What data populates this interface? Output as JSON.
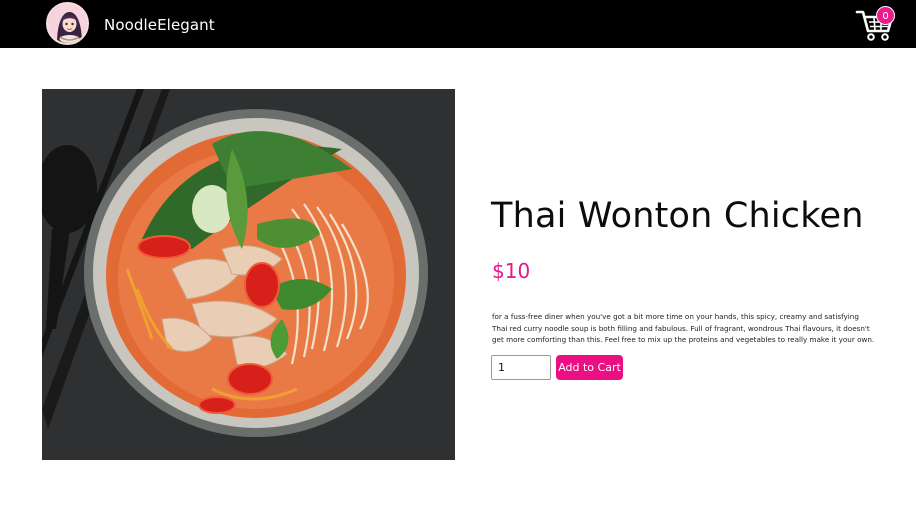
{
  "navbar": {
    "brand": "NoodleElegant",
    "logo_icon": "noodle-girl-logo",
    "cart_icon": "shopping-cart-icon",
    "cart_count": "0"
  },
  "product": {
    "image_alt": "Bowl of Thai red curry noodle soup with chicken, chilli, basil and bok choy",
    "title": "Thai Wonton Chicken",
    "price": "$10",
    "description": "for a fuss-free diner when you've got a bit more time on your hands, this spicy, creamy and satisfying Thai red curry noodle soup is both filling and fabulous. Full of fragrant, wondrous Thai flavours, it doesn't get more comforting than this. Feel free to mix up the proteins and vegetables to really make it your own.",
    "quantity": "1",
    "add_to_cart_label": "Add to Cart"
  },
  "colors": {
    "navbar_bg": "#000000",
    "accent": "#ec0f84",
    "price": "#e5168a"
  }
}
